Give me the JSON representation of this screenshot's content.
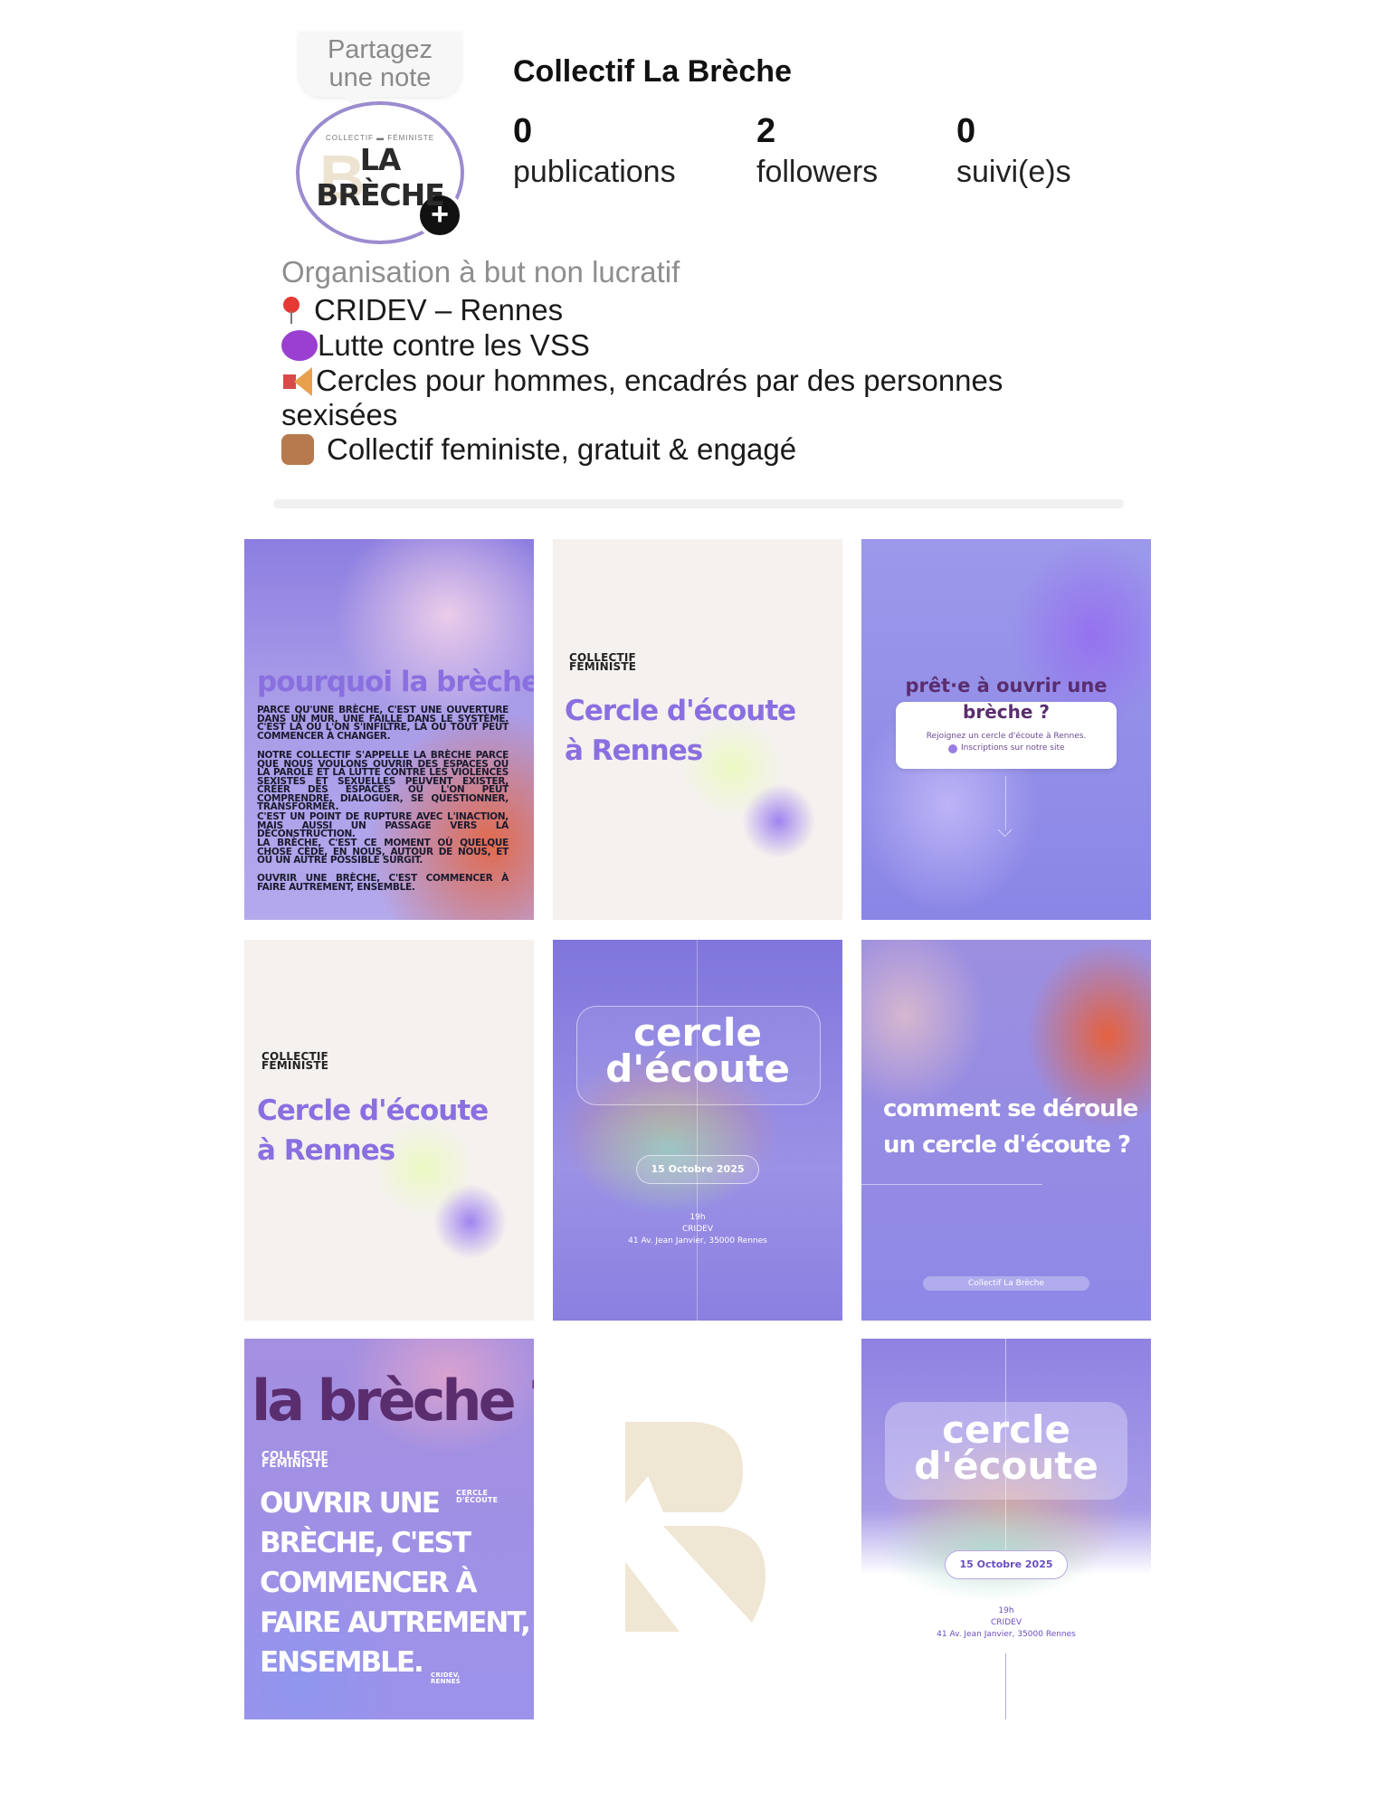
{
  "profile": {
    "note": [
      "Partagez",
      "une note"
    ],
    "avatar_text_small": "COLLECTIF ▬ FÉMINISTE",
    "avatar_text_big": "LA BRÈCHE",
    "avatar_add": "+",
    "name": "Collectif La Brèche",
    "stats": [
      {
        "value": "0",
        "label": "publications"
      },
      {
        "value": "2",
        "label": "followers"
      },
      {
        "value": "0",
        "label": "suivi(e)s"
      }
    ],
    "category": "Organisation à but non lucratif",
    "bio": {
      "line1": "CRIDEV – Rennes",
      "line2": "Lutte contre les VSS",
      "line3a": "Cercles pour hommes, encadrés par des personnes",
      "line3b": "sexisées",
      "line4": "Collectif feministe, gratuit & engagé"
    }
  },
  "posts": {
    "p1": {
      "title": "pourquoi la brèche ?",
      "para1": "PARCE QU'UNE BRÈCHE, C'EST UNE OUVERTURE DANS UN MUR, UNE FAILLE DANS LE SYSTÈME. C'EST LÀ OÙ L'ON S'INFILTRE, LÀ OÙ TOUT PEUT COMMENCER À CHANGER.",
      "para2": "NOTRE COLLECTIF S'APPELLE LA BRÈCHE PARCE QUE NOUS VOULONS OUVRIR DES ESPACES OÙ LA PAROLE ET LA LUTTE CONTRE LES VIOLENCES SEXISTES ET SEXUELLES PEUVENT EXISTER, CRÉER DES ESPACES OÙ L'ON PEUT COMPRENDRE, DIALOGUER, SE QUESTIONNER, TRANSFORMER.",
      "para3": "C'EST UN POINT DE RUPTURE AVEC L'INACTION, MAIS AUSSI UN PASSAGE VERS LA DÉCONSTRUCTION.",
      "para4": "LA BRÈCHE, C'EST CE MOMENT OÙ QUELQUE CHOSE CÈDE, EN NOUS, AUTOUR DE NOUS, ET OÙ UN AUTRE POSSIBLE SURGIT.",
      "para5": "OUVRIR UNE BRÈCHE, C'EST COMMENCER À FAIRE AUTREMENT, ENSEMBLE."
    },
    "p2": {
      "label1": "COLLECTIF",
      "label2": "FÉMINISTE",
      "title1": "Cercle d'écoute",
      "title2": "à Rennes"
    },
    "p3": {
      "title1": "prêt·e à ouvrir une",
      "title2": "brèche ?",
      "card1": "Rejoignez un cercle d'écoute à Rennes.",
      "card2": "Inscriptions sur notre site"
    },
    "p4": {
      "label1": "COLLECTIF",
      "label2": "FÉMINISTE",
      "title1": "Cercle d'écoute",
      "title2": "à Rennes"
    },
    "p5": {
      "title1": "cercle",
      "title2": "d'écoute",
      "date": "15 Octobre 2025",
      "time": "19h",
      "place": "CRIDEV",
      "address": "41 Av. Jean Janvier, 35000 Rennes"
    },
    "p6": {
      "title1": "comment se déroule",
      "title2": "un cercle d'écoute ?",
      "footer": "Collectif La Brèche"
    },
    "p7": {
      "title": "la brèche ?",
      "label1": "COLLECTIF",
      "label2": "FÉMINISTE",
      "tag1": "CERCLE",
      "tag2": "D'ÉCOUTE",
      "body": [
        "OUVRIR UNE",
        "BRÈCHE, C'EST",
        "COMMENCER À",
        "FAIRE AUTREMENT,",
        "ENSEMBLE."
      ],
      "sig1": "CRIDEV,",
      "sig2": "RENNES"
    },
    "p8": {
      "logo": "B-monogram-logo"
    },
    "p9": {
      "title1": "cercle",
      "title2": "d'écoute",
      "date": "15 Octobre 2025",
      "time": "19h",
      "place": "CRIDEV",
      "address": "41 Av. Jean Janvier, 35000 Rennes"
    }
  },
  "colors": {
    "accent_purple": "#8a6fe0",
    "dark_plum": "#5a2d6e",
    "cream_logo": "#efe6d3"
  }
}
